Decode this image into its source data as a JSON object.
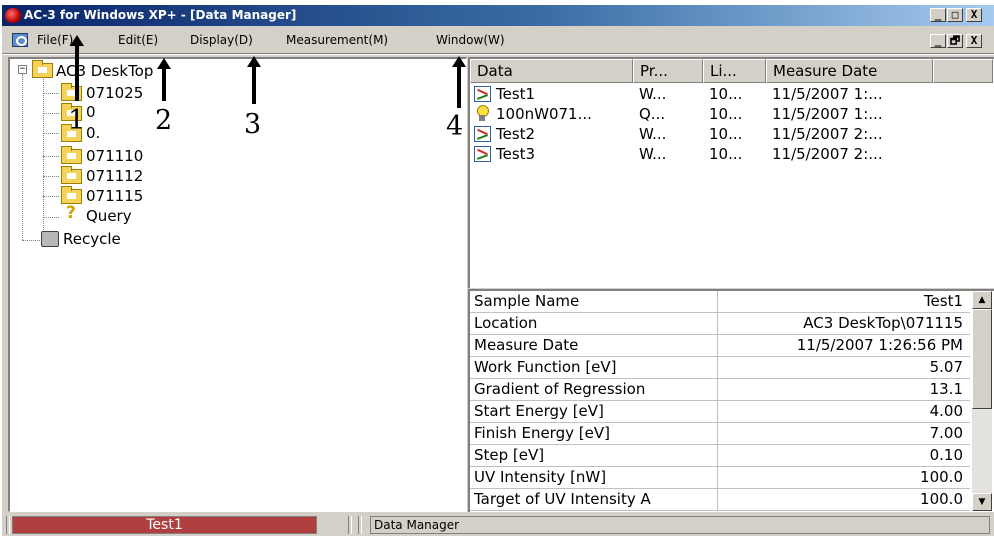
{
  "window": {
    "title": "AC-3 for Windows XP+ - [Data Manager]",
    "minimize_label": "_",
    "restore_label": "□",
    "close_label": "X"
  },
  "menu": {
    "items": [
      "File(F)",
      "Edit(E)",
      "Display(D)",
      "Measurement(M)",
      "Window(W)"
    ],
    "mdi_minimize": "_",
    "mdi_restore": "🗗",
    "mdi_close": "X"
  },
  "tree": {
    "root": "AC3 DeskTop",
    "folders": [
      "071025",
      "0",
      "0.",
      "071110",
      "071112",
      "071115"
    ],
    "query": "Query",
    "recycle": "Recycle"
  },
  "list": {
    "columns": [
      "Data",
      "Pr...",
      "Li...",
      "Measure Date"
    ],
    "rows": [
      {
        "name": "Test1",
        "pr": "W...",
        "li": "10...",
        "date": "11/5/2007 1:...",
        "icon": "data-icon"
      },
      {
        "name": "100nW071...",
        "pr": "Q...",
        "li": "10...",
        "date": "11/5/2007 1:...",
        "icon": "bulb-icon"
      },
      {
        "name": "Test2",
        "pr": "W...",
        "li": "10...",
        "date": "11/5/2007 2:...",
        "icon": "data-icon"
      },
      {
        "name": "Test3",
        "pr": "W...",
        "li": "10...",
        "date": "11/5/2007 2:...",
        "icon": "data-icon"
      }
    ]
  },
  "properties": [
    {
      "name": "Sample Name",
      "value": "Test1"
    },
    {
      "name": "Location",
      "value": "AC3 DeskTop\\071115"
    },
    {
      "name": "Measure Date",
      "value": "11/5/2007 1:26:56 PM"
    },
    {
      "name": "Work Function [eV]",
      "value": "5.07"
    },
    {
      "name": "Gradient of Regression",
      "value": "13.1"
    },
    {
      "name": "Start Energy [eV]",
      "value": "4.00"
    },
    {
      "name": "Finish Energy [eV]",
      "value": "7.00"
    },
    {
      "name": "Step [eV]",
      "value": "0.10"
    },
    {
      "name": "UV Intensity [nW]",
      "value": "100.0"
    },
    {
      "name": "Target of UV Intensity A",
      "value": "100.0"
    }
  ],
  "statusbar": {
    "selected": "Test1",
    "text": "Data Manager"
  },
  "annotations": [
    "1",
    "2",
    "3",
    "4"
  ],
  "colors": {
    "title_start": "#0a246a",
    "title_end": "#a6caf0",
    "status_selected": "#b04040",
    "face": "#d4d0c8"
  }
}
